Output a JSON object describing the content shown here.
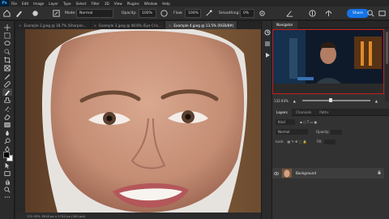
{
  "app": {
    "logo": "Ps"
  },
  "menu": [
    "File",
    "Edit",
    "Image",
    "Layer",
    "Type",
    "Select",
    "Filter",
    "3D",
    "View",
    "Plugins",
    "Window",
    "Help"
  ],
  "options": {
    "mode_label": "Mode:",
    "mode_value": "Normal",
    "opacity_label": "Opacity:",
    "opacity_value": "100%",
    "flow_label": "Flow:",
    "flow_value": "100%",
    "smoothing_label": "Smoothing:",
    "smoothing_value": "0%",
    "share_label": "Share"
  },
  "tabs": [
    {
      "label": "Example 2.jpeg @ 18.7% (Sharpen...",
      "active": false
    },
    {
      "label": "Example 3.jpeg @ 48.6% (Eye Cris...",
      "active": false
    },
    {
      "label": "Example 4.jpeg @ 13.5% (RGB/8#)",
      "active": true
    }
  ],
  "status": {
    "text": "132.93%   3818 px x 2744 px (300 ppi)"
  },
  "navigator": {
    "tab_active": "Navigator",
    "zoom_value": "132.93%",
    "zoom_fraction": 0.42
  },
  "layers": {
    "tabs": [
      "Layers",
      "Channels",
      "Paths"
    ],
    "filter_label": "Kind",
    "blend": "Normal",
    "opacity_label": "Opacity:",
    "lock_label": "Lock:",
    "fill_label": "Fill:",
    "items": [
      {
        "name": "Background",
        "visible": true,
        "locked": true
      }
    ]
  },
  "colors": {
    "accent": "#1473e6",
    "foreground": "#000000",
    "background": "#ffffff",
    "nav_frame": "#c41e1e"
  },
  "icons": [
    "move-icon",
    "marquee-icon",
    "lasso-icon",
    "quick-select-icon",
    "crop-icon",
    "frame-icon",
    "eyedropper-icon",
    "healing-icon",
    "brush-icon",
    "stamp-icon",
    "history-brush-icon",
    "eraser-icon",
    "gradient-icon",
    "blur-icon",
    "dodge-icon",
    "pen-icon",
    "type-icon",
    "path-select-icon",
    "shape-icon",
    "hand-icon",
    "zoom-icon",
    "edit-toolbar-icon"
  ]
}
